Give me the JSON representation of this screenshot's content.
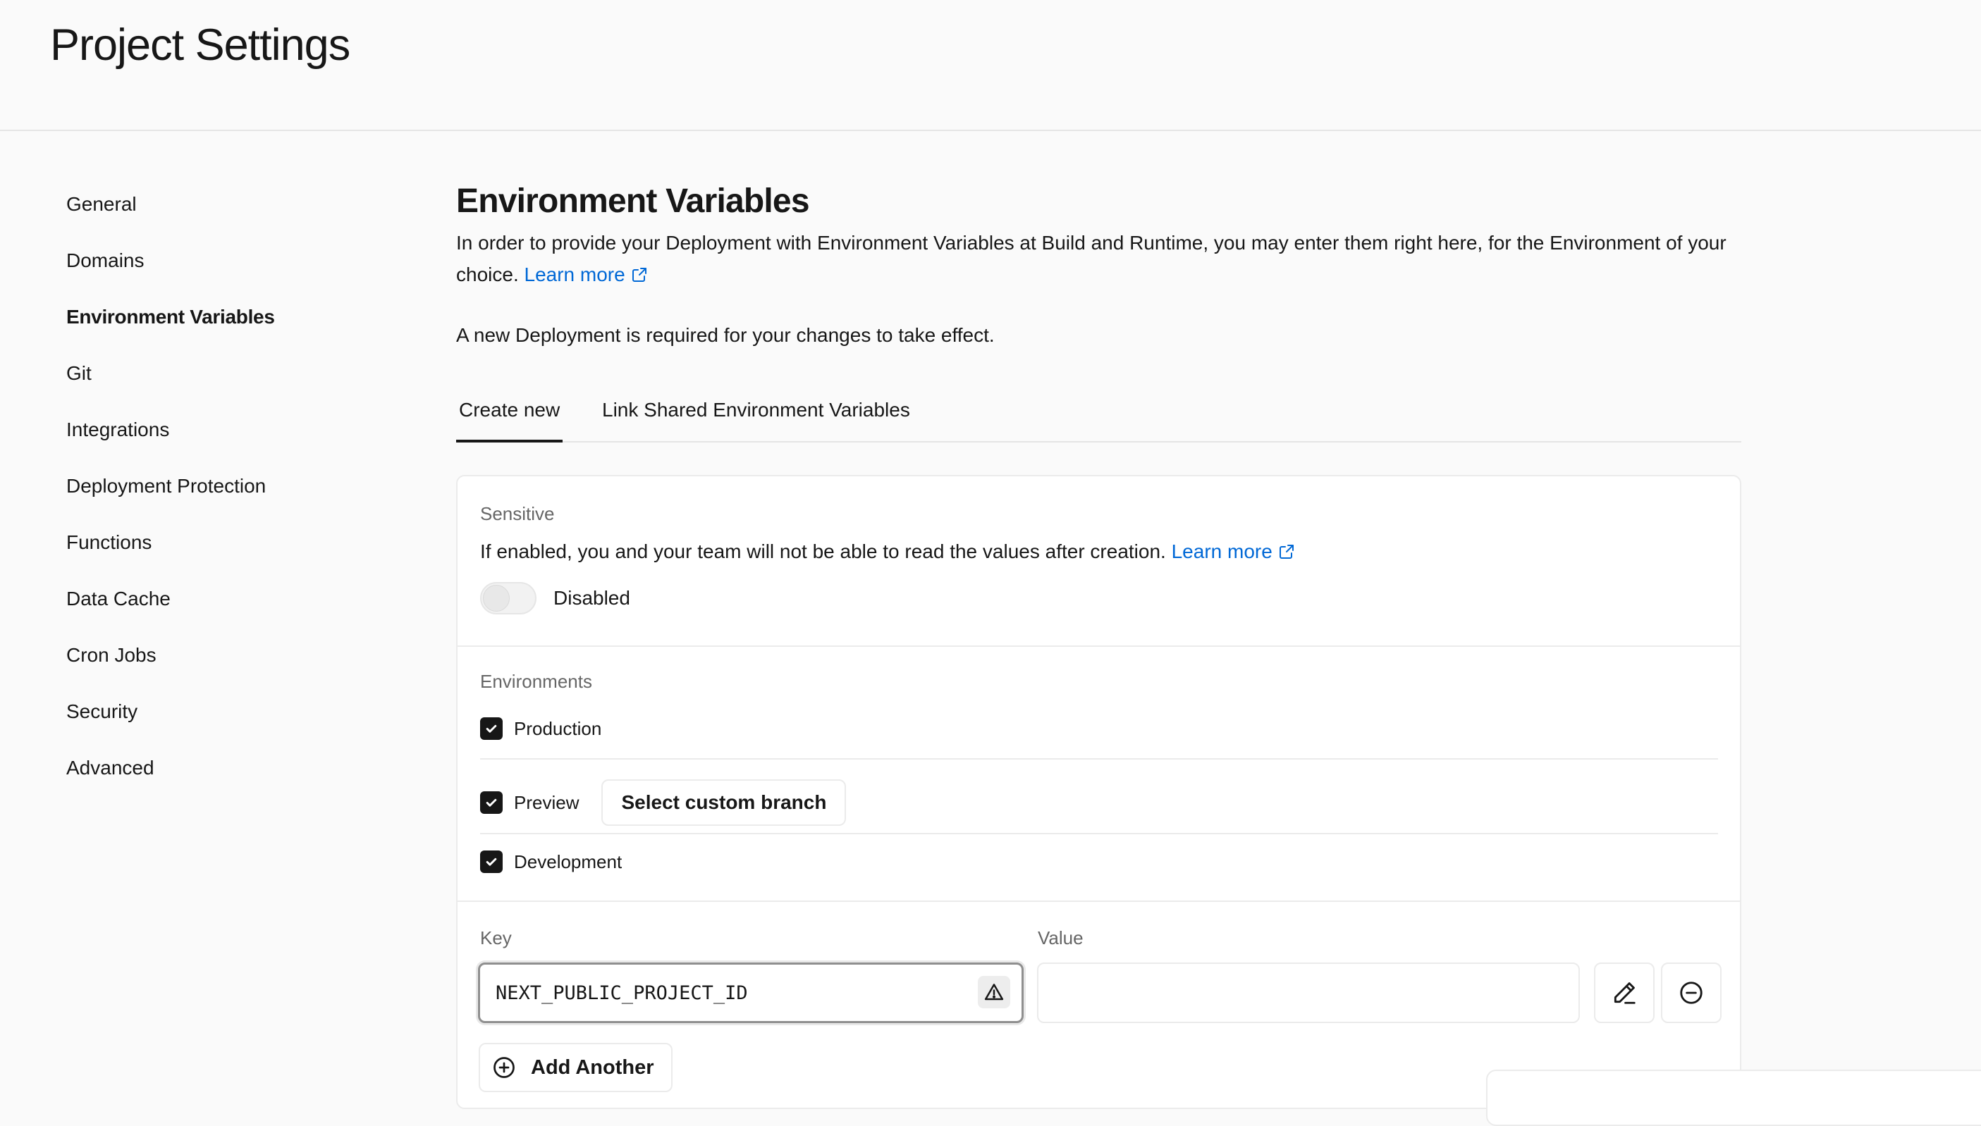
{
  "header": {
    "title": "Project Settings"
  },
  "sidebar": {
    "items": [
      {
        "label": "General",
        "active": false
      },
      {
        "label": "Domains",
        "active": false
      },
      {
        "label": "Environment Variables",
        "active": true
      },
      {
        "label": "Git",
        "active": false
      },
      {
        "label": "Integrations",
        "active": false
      },
      {
        "label": "Deployment Protection",
        "active": false
      },
      {
        "label": "Functions",
        "active": false
      },
      {
        "label": "Data Cache",
        "active": false
      },
      {
        "label": "Cron Jobs",
        "active": false
      },
      {
        "label": "Security",
        "active": false
      },
      {
        "label": "Advanced",
        "active": false
      }
    ]
  },
  "main": {
    "title": "Environment Variables",
    "description": "In order to provide your Deployment with Environment Variables at Build and Runtime, you may enter them right here, for the Environment of your choice.",
    "learn_more": "Learn more",
    "note": "A new Deployment is required for your changes to take effect.",
    "tabs": [
      {
        "label": "Create new",
        "active": true
      },
      {
        "label": "Link Shared Environment Variables",
        "active": false
      }
    ]
  },
  "form": {
    "sensitive": {
      "label": "Sensitive",
      "description": "If enabled, you and your team will not be able to read the values after creation.",
      "learn_more": "Learn more",
      "toggle_state": "Disabled",
      "enabled": false
    },
    "environments": {
      "label": "Environments",
      "items": [
        {
          "label": "Production",
          "checked": true
        },
        {
          "label": "Preview",
          "checked": true
        },
        {
          "label": "Development",
          "checked": true
        }
      ],
      "branch_button": "Select custom branch"
    },
    "key": {
      "label": "Key",
      "value": "NEXT_PUBLIC_PROJECT_ID"
    },
    "value": {
      "label": "Value",
      "value": ""
    },
    "add_another": "Add Another"
  },
  "colors": {
    "background": "#fafafa",
    "link": "#0068d6",
    "text": "#171717",
    "muted": "#666666",
    "border": "#ebebeb"
  },
  "icons": [
    "external-link-icon",
    "check-icon",
    "warning-icon",
    "edit-pencil-icon",
    "remove-circle-icon",
    "add-circle-icon"
  ]
}
